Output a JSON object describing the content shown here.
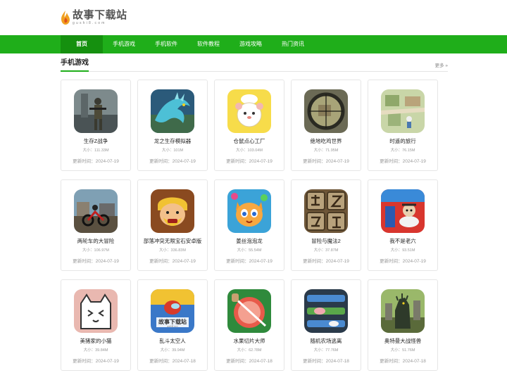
{
  "site": {
    "title": "故事下载站",
    "subtitle": "gushi8.com",
    "brand_color": "#1fae1a"
  },
  "nav": {
    "items": [
      {
        "label": "首页",
        "active": true
      },
      {
        "label": "手机游戏"
      },
      {
        "label": "手机软件"
      },
      {
        "label": "软件教程"
      },
      {
        "label": "游戏攻略"
      },
      {
        "label": "热门资讯"
      }
    ]
  },
  "section": {
    "title": "手机游戏",
    "more": "更多 »"
  },
  "apps": [
    {
      "name": "生存Z战争",
      "size": "大小：111.33M",
      "date": "更新时间：2024-07-19",
      "icon": "soldier-icon"
    },
    {
      "name": "龙之生存模拟器",
      "size": "大小：101M",
      "date": "更新时间：2024-07-19",
      "icon": "dragon-icon"
    },
    {
      "name": "仓鼠点心工厂",
      "size": "大小：103.04M",
      "date": "更新时间：2024-07-19",
      "icon": "hamster-chef-icon"
    },
    {
      "name": "绝地吃鸡世界",
      "size": "大小：71.95M",
      "date": "更新时间：2024-07-19",
      "icon": "scope-icon"
    },
    {
      "name": "时遥的旅行",
      "size": "大小：76.15M",
      "date": "更新时间：2024-07-19",
      "icon": "travel-icon"
    },
    {
      "name": "两轮车的大冒险",
      "size": "大小：106.97M",
      "date": "更新时间：2024-07-19",
      "icon": "bike-icon"
    },
    {
      "name": "部落冲突无限宝石安卓版",
      "size": "大小：336.83M",
      "date": "更新时间：2024-07-19",
      "icon": "barbarian-icon"
    },
    {
      "name": "姜丝泡泡龙",
      "size": "大小：55.54M",
      "date": "更新时间：2024-07-19",
      "icon": "cat-bubble-icon"
    },
    {
      "name": "冒险与魔法2",
      "size": "大小：37.87M",
      "date": "更新时间：2024-07-19",
      "icon": "stone-tiles-icon"
    },
    {
      "name": "我不是老六",
      "size": "大小：93.51M",
      "date": "更新时间：2024-07-19",
      "icon": "toilet-monster-icon"
    },
    {
      "name": "美猪家的小猫",
      "size": "大小：39.84M",
      "date": "更新时间：2024-07-19",
      "icon": "white-cat-icon"
    },
    {
      "name": "乱斗太空人",
      "size": "大小：39.94M",
      "date": "更新时间：2024-07-18",
      "icon": "astronaut-icon",
      "watermark": "故事下载站",
      "watermark_sub": "gushi8.com"
    },
    {
      "name": "水果切片大师",
      "size": "大小：62.78M",
      "date": "更新时间：2024-07-18",
      "icon": "fruit-slice-icon"
    },
    {
      "name": "随机农场逃离",
      "size": "大小：77.76M",
      "date": "更新时间：2024-07-18",
      "icon": "farm-maze-icon"
    },
    {
      "name": "奥特曼大战怪兽",
      "size": "大小：51.76M",
      "date": "更新时间：2024-07-18",
      "icon": "kaiju-icon"
    }
  ]
}
